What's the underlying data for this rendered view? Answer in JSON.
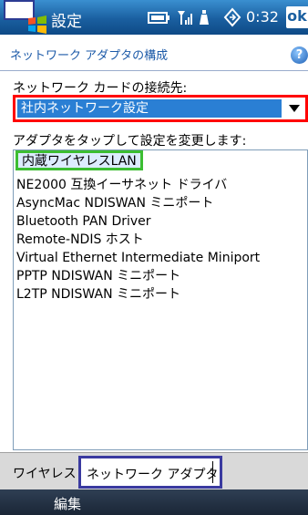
{
  "titlebar": {
    "app_title": "設定",
    "clock": "0:32",
    "ok_label": "ok"
  },
  "header": {
    "page_title": "ネットワーク アダプタの構成",
    "help_label": "?"
  },
  "form": {
    "connect_label": "ネットワーク カードの接続先:",
    "selected_network": "社内ネットワーク設定",
    "adapter_label": "アダプタをタップして設定を変更します:"
  },
  "adapters": [
    "内蔵ワイヤレスLAN",
    "NE2000 互換イーサネット ドライバ",
    "AsyncMac NDISWAN ミニポート",
    "Bluetooth PAN Driver",
    "Remote-NDIS ホスト",
    "Virtual Ethernet Intermediate Miniport",
    "PPTP NDISWAN ミニポート",
    "L2TP NDISWAN ミニポート"
  ],
  "tabs": {
    "wireless": "ワイヤレス",
    "adapter": "ネットワーク アダプタ"
  },
  "softkeys": {
    "left": "編集"
  },
  "colors": {
    "titlebar": "#1a5fa0",
    "highlight_red": "#ff0000",
    "highlight_green": "#3cbe32",
    "highlight_navy": "#3a3aa0",
    "selection_blue": "#2a7fd4"
  }
}
